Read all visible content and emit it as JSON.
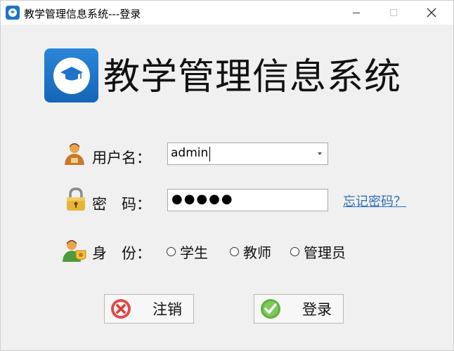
{
  "window": {
    "title": "教学管理信息系统---登录",
    "app_icon": "graduation-cap-icon",
    "controls": [
      "minimize",
      "maximize",
      "close"
    ]
  },
  "header": {
    "logo_icon": "graduation-cap-logo",
    "app_name": "教学管理信息系统",
    "brand_color": "#1e73c9"
  },
  "form": {
    "username": {
      "label": "用户名：",
      "icon": "user-icon",
      "value": "admin"
    },
    "password": {
      "label": "密　码：",
      "icon": "padlock-icon",
      "masked_value": "●●●●●",
      "forgot_link": "忘记密码？"
    },
    "role": {
      "label": "身　份：",
      "icon": "user-badge-icon",
      "options": [
        "学生",
        "教师",
        "管理员"
      ]
    }
  },
  "buttons": {
    "cancel": {
      "label": "注销",
      "icon": "red-x-icon"
    },
    "login": {
      "label": "登录",
      "icon": "green-check-icon"
    }
  }
}
